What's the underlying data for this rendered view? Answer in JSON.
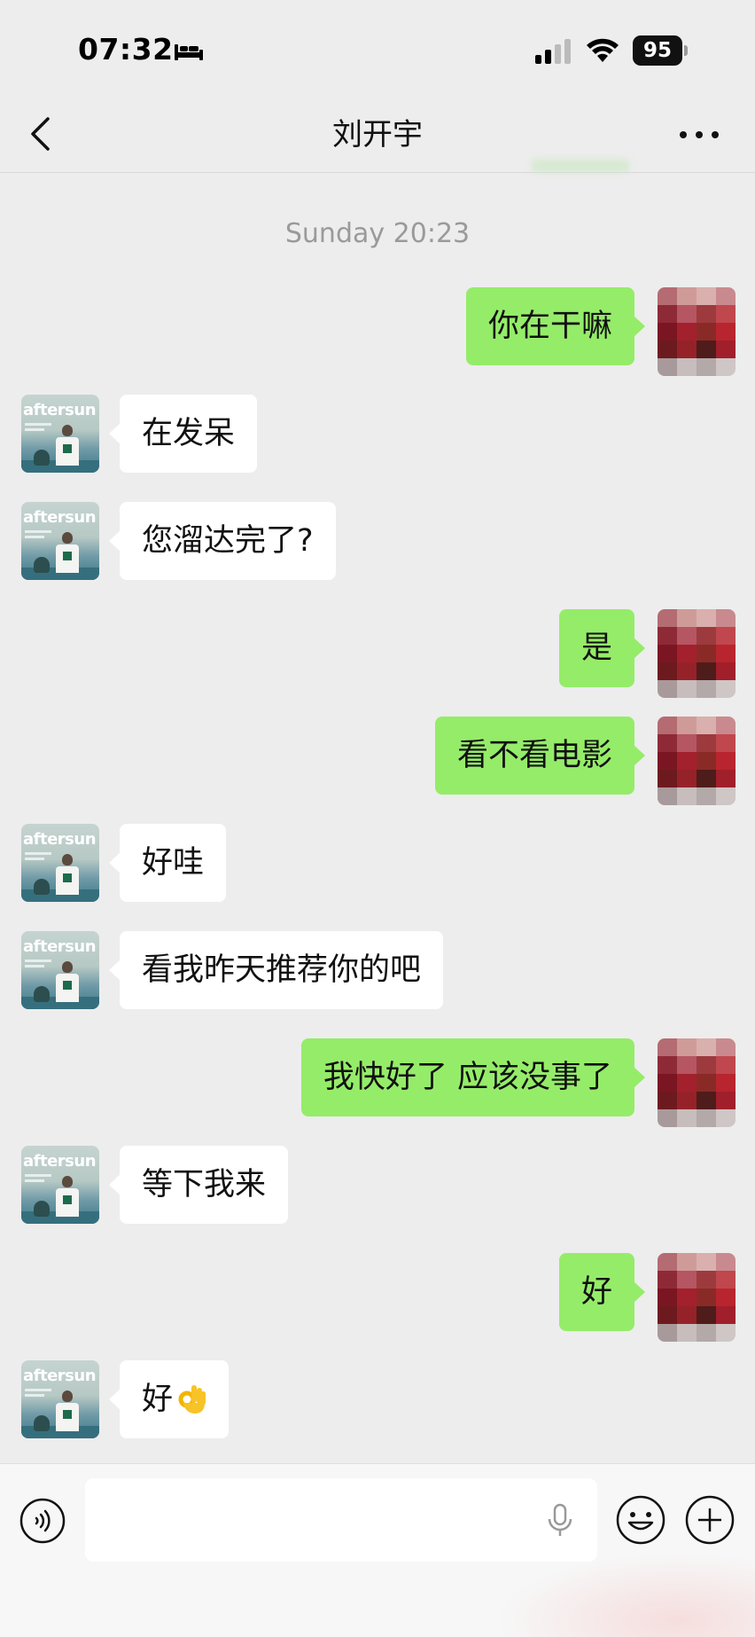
{
  "status_bar": {
    "time": "07:32",
    "battery": "95",
    "icons": [
      "bed-icon",
      "cellular-signal-icon",
      "wifi-icon",
      "battery-icon"
    ]
  },
  "nav": {
    "title": "刘开宇",
    "back_icon": "chevron-left-icon",
    "more_icon": "more-dots-icon"
  },
  "chat": {
    "timestamp": "Sunday 20:23",
    "messages": [
      {
        "from": "me",
        "text": "你在干嘛"
      },
      {
        "from": "contact",
        "text": "在发呆"
      },
      {
        "from": "contact",
        "text": "您溜达完了?"
      },
      {
        "from": "me",
        "text": "是"
      },
      {
        "from": "me",
        "text": "看不看电影"
      },
      {
        "from": "contact",
        "text": "好哇"
      },
      {
        "from": "contact",
        "text": "看我昨天推荐你的吧"
      },
      {
        "from": "me",
        "text": "我快好了 应该没事了"
      },
      {
        "from": "contact",
        "text": "等下我来"
      },
      {
        "from": "me",
        "text": "好"
      },
      {
        "from": "contact",
        "text": "好",
        "emoji": "ok-hand-emoji"
      }
    ],
    "contact_avatar_text": "aftersun"
  },
  "input_bar": {
    "value": "",
    "icons": [
      "voice-icon",
      "microphone-icon",
      "emoji-icon",
      "plus-icon"
    ]
  },
  "colors": {
    "background": "#ededed",
    "my_bubble": "#95ec69",
    "their_bubble": "#ffffff",
    "timestamp": "#9a9a9a"
  }
}
